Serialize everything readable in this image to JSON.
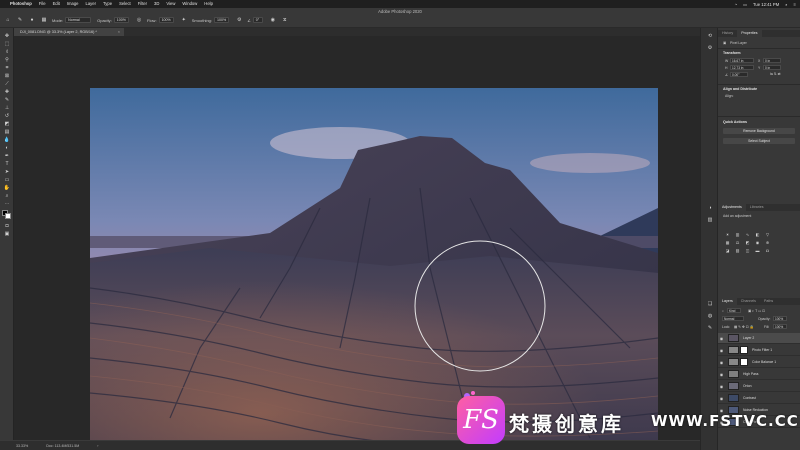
{
  "menubar": {
    "app": "Photoshop",
    "items": [
      "File",
      "Edit",
      "Image",
      "Layer",
      "Type",
      "Select",
      "Filter",
      "3D",
      "View",
      "Window",
      "Help"
    ],
    "clock": "Tue 12:41 PM"
  },
  "window_title": "Adobe Photoshop 2020",
  "options": {
    "mode_label": "Mode:",
    "mode_value": "Normal",
    "opacity_label": "Opacity:",
    "opacity_value": "100%",
    "flow_label": "Flow:",
    "flow_value": "100%",
    "smoothing_label": "Smoothing:",
    "smoothing_value": "100%",
    "angle_value": "0°"
  },
  "document_tab": {
    "label": "DJI_0081.DNG @ 33.3% (Layer 2, RGB/16) *"
  },
  "status": {
    "zoom": "33.33%",
    "doc": "Doc: 113.4M/531.5M"
  },
  "panel": {
    "top_tabs": [
      "History",
      "Properties"
    ],
    "pixel_layer": "Pixel Layer",
    "transform_heading": "Transform",
    "w_label": "W",
    "w_value": "16.67 in",
    "h_label": "H",
    "h_value": "12.73 in",
    "x_label": "X",
    "x_value": "0 in",
    "y_label": "Y",
    "y_value": "0 in",
    "angle_value": "0.00°",
    "align_heading": "Align and Distribute",
    "align_sub": "Align:",
    "quick_heading": "Quick Actions",
    "remove_bg": "Remove Background",
    "select_subject": "Select Subject",
    "adj_tabs": [
      "Adjustments",
      "Libraries"
    ],
    "adj_sub": "Add an adjustment",
    "layers_tabs": [
      "Layers",
      "Channels",
      "Paths"
    ],
    "kind_label": "Kind",
    "blend_mode": "Normal",
    "opacity_label": "Opacity:",
    "opacity_value": "100%",
    "lock_label": "Lock:",
    "fill_label": "Fill:",
    "fill_value": "100%"
  },
  "layers": [
    {
      "name": "Layer 2",
      "selected": true,
      "thumb": "#5a5563",
      "mask": false
    },
    {
      "name": "Photo Filter 1",
      "selected": false,
      "thumb": "#888888",
      "mask": true
    },
    {
      "name": "Color Balance 1",
      "selected": false,
      "thumb": "#888888",
      "mask": true
    },
    {
      "name": "High Pass",
      "selected": false,
      "thumb": "#7f7f7f",
      "mask": false
    },
    {
      "name": "Orton",
      "selected": false,
      "thumb": "#6b6a78",
      "mask": false
    },
    {
      "name": "Contrast",
      "selected": false,
      "thumb": "#3d4a66",
      "mask": false
    },
    {
      "name": "Noise Reduction",
      "selected": false,
      "thumb": "#4e5a7a",
      "mask": false
    },
    {
      "name": "Color Fix",
      "selected": false,
      "thumb": "#4f5b7c",
      "mask": false
    }
  ],
  "watermark": {
    "logo": "FS",
    "cn_text": "梵摄创意库",
    "url": "WWW.FSTVC.CC"
  },
  "icons": {
    "tools": [
      "move-tool-icon",
      "marquee-tool-icon",
      "lasso-tool-icon",
      "magic-wand-icon",
      "crop-tool-icon",
      "frame-tool-icon",
      "eyedropper-icon",
      "healing-brush-icon",
      "brush-tool-icon",
      "clone-stamp-icon",
      "history-brush-icon",
      "eraser-icon",
      "gradient-tool-icon",
      "blur-tool-icon",
      "dodge-tool-icon",
      "pen-tool-icon",
      "type-tool-icon",
      "path-select-icon",
      "rectangle-tool-icon",
      "hand-tool-icon",
      "zoom-tool-icon"
    ]
  }
}
